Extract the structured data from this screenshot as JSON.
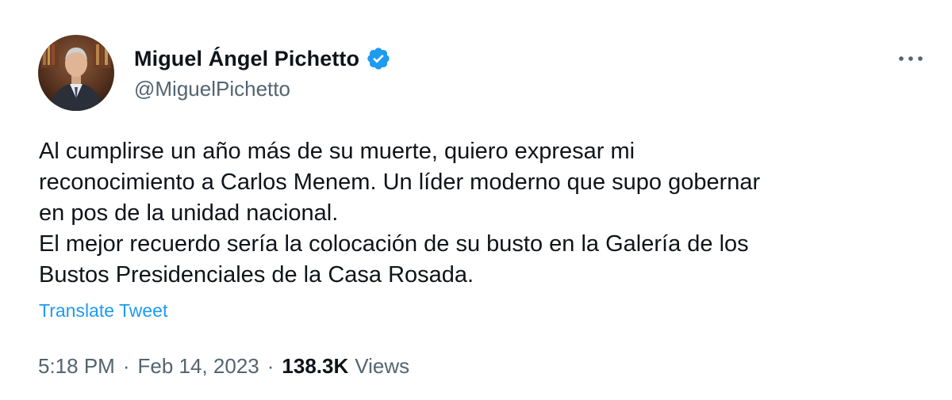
{
  "author": {
    "display_name": "Miguel Ángel Pichetto",
    "handle": "@MiguelPichetto",
    "verified": true
  },
  "tweet": {
    "text": "Al cumplirse un año más de su muerte, quiero expresar mi\nreconocimiento a Carlos Menem. Un líder moderno que supo gobernar\nen pos de la unidad nacional.\nEl mejor recuerdo sería la colocación de su busto en la Galería de los\nBustos Presidenciales de la Casa Rosada.",
    "translate_label": "Translate Tweet",
    "time": "5:18 PM",
    "separator": "·",
    "date": "Feb 14, 2023",
    "views_count": "138.3K",
    "views_label": "Views"
  },
  "icons": {
    "verified": "verified-badge-icon",
    "more": "more-options-icon"
  },
  "colors": {
    "accent": "#1d9bf0",
    "secondary_text": "#536471",
    "primary_text": "#0f1419"
  }
}
